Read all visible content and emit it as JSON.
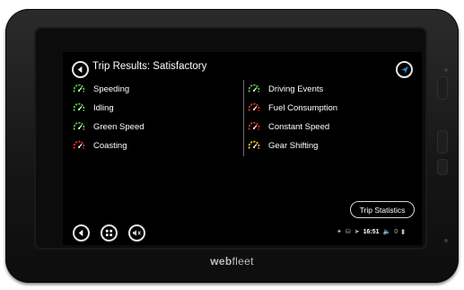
{
  "header": {
    "title": "Trip Results: Satisfactory"
  },
  "results": {
    "left": [
      {
        "label": "Speeding",
        "status": "good",
        "color": "#52c93a"
      },
      {
        "label": "Idling",
        "status": "good",
        "color": "#52c93a"
      },
      {
        "label": "Green Speed",
        "status": "good",
        "color": "#52c93a"
      },
      {
        "label": "Coasting",
        "status": "poor",
        "color": "#d9342b"
      }
    ],
    "right": [
      {
        "label": "Driving Events",
        "status": "good",
        "color": "#52c93a"
      },
      {
        "label": "Fuel Consumption",
        "status": "poor",
        "color": "#d9342b"
      },
      {
        "label": "Constant Speed",
        "status": "poor",
        "color": "#d9342b"
      },
      {
        "label": "Gear Shifting",
        "status": "fair",
        "color": "#f2c21b"
      }
    ]
  },
  "buttons": {
    "trip_statistics": "Trip Statistics"
  },
  "status_bar": {
    "time": "16:51",
    "counter": "0"
  },
  "brand": {
    "bold": "web",
    "regular": "fleet"
  },
  "icons": {
    "back": "back-arrow-icon",
    "navigation": "navigation-arrow-icon",
    "menu": "grid-menu-icon",
    "mute": "speaker-mute-icon",
    "gauge": "gauge-icon"
  },
  "colors": {
    "accent": "#2a8fd6",
    "good": "#52c93a",
    "poor": "#d9342b",
    "fair": "#f2c21b"
  }
}
